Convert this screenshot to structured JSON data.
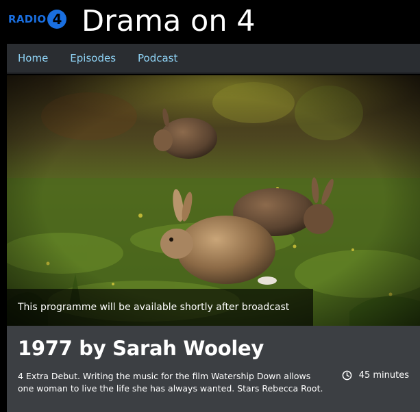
{
  "header": {
    "station_word": "RADIO",
    "station_number": "4",
    "brand_title": "Drama on 4"
  },
  "nav": {
    "items": [
      {
        "label": "Home"
      },
      {
        "label": "Episodes"
      },
      {
        "label": "Podcast"
      }
    ]
  },
  "hero": {
    "availability_text": "This programme will be available shortly after broadcast"
  },
  "episode": {
    "title": "1977 by Sarah Wooley",
    "synopsis": "4 Extra Debut. Writing the music for the film Watership Down allows one woman to live the life she has always wanted. Stars Rebecca Root.",
    "duration": "45 minutes",
    "duration_icon": "clock-icon"
  },
  "colors": {
    "station_blue": "#1a6fe0",
    "nav_link": "#8fd3f5",
    "nav_bg": "#2a2d31",
    "info_bg": "#3c3f43"
  }
}
